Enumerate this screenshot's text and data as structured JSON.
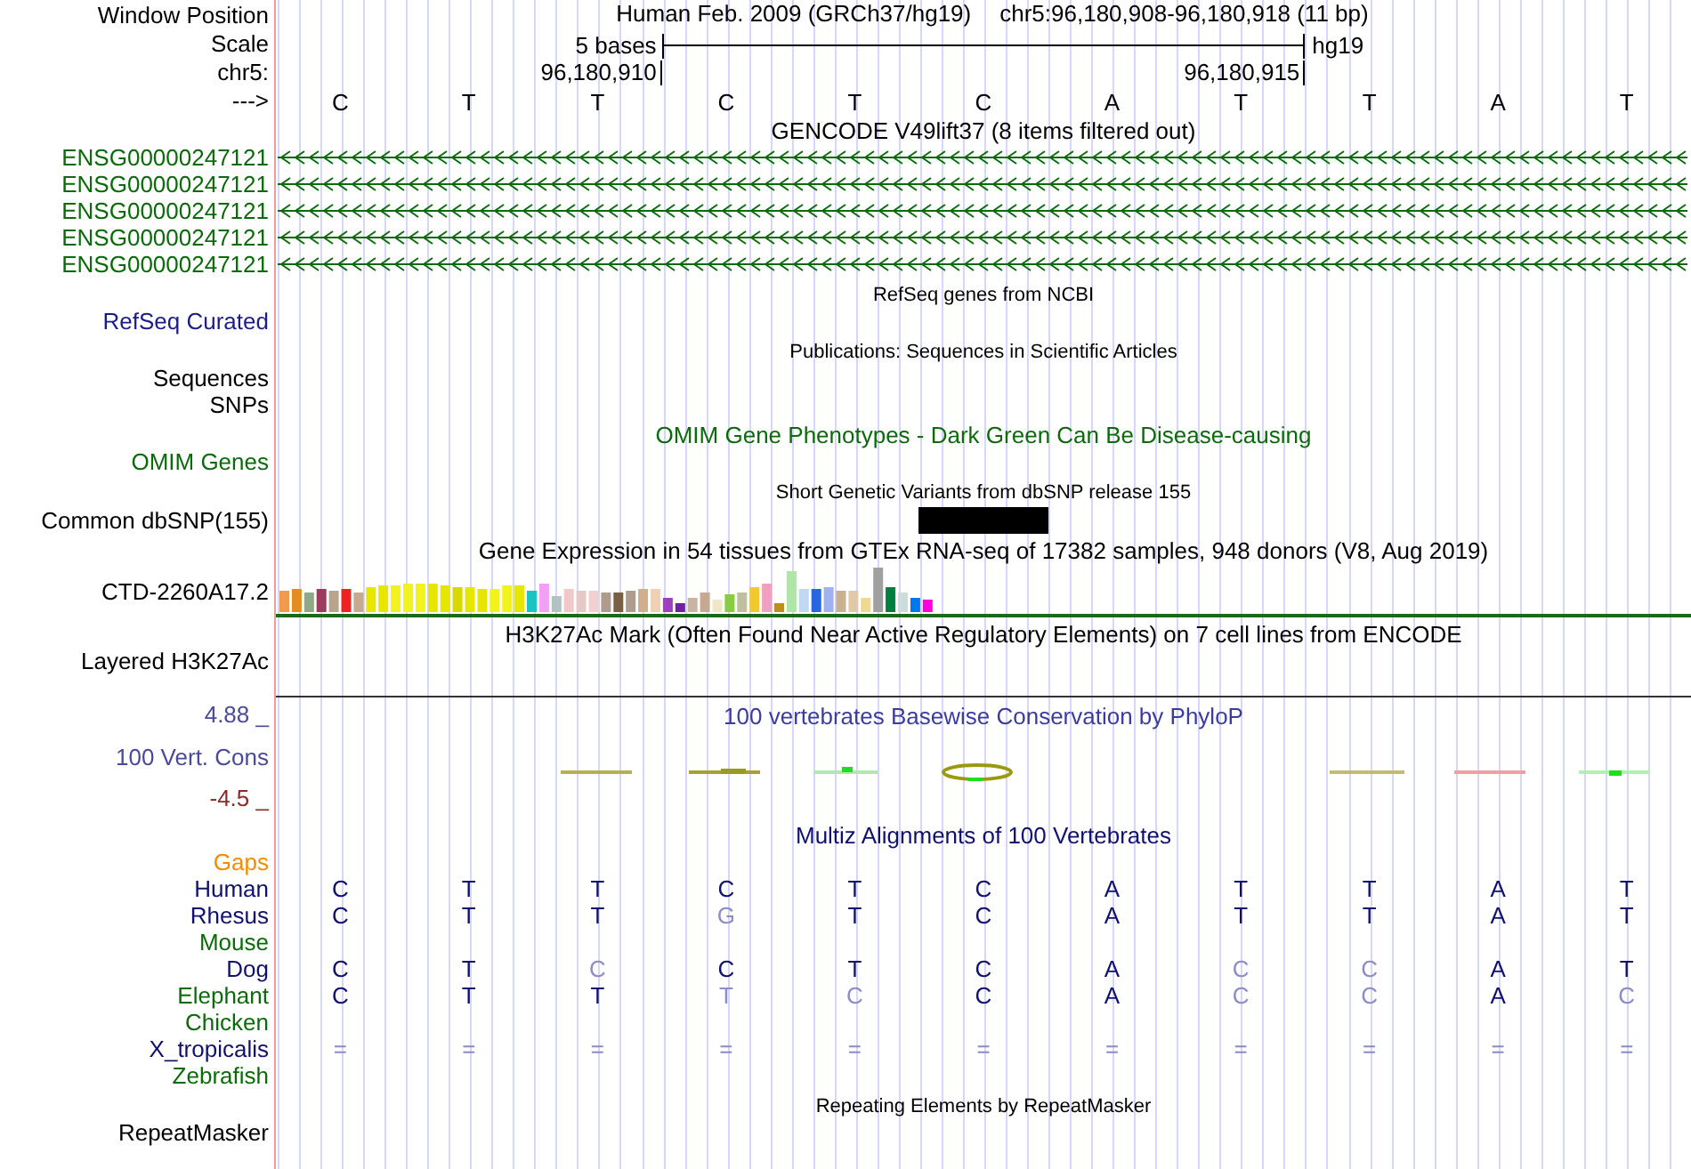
{
  "header": {
    "position": {
      "label": "Window Position",
      "assembly": "Human Feb. 2009 (GRCh37/hg19)",
      "range": "chr5:96,180,908-96,180,918 (11 bp)"
    },
    "scale": {
      "label": "Scale",
      "length": "5 bases",
      "genome": "hg19"
    },
    "ruler": {
      "label": "chr5:",
      "ticks": [
        "96,180,910",
        "96,180,915"
      ]
    },
    "sequence": {
      "label": "--->",
      "bases": [
        "C",
        "T",
        "T",
        "C",
        "T",
        "C",
        "A",
        "T",
        "T",
        "A",
        "T"
      ]
    }
  },
  "rows": [
    {
      "kind": "title",
      "text": "GENCODE V49lift37 (8 items filtered out)",
      "color": "#000000"
    },
    {
      "kind": "gene",
      "label": "ENSG00000247121",
      "color": "#0b6b0b"
    },
    {
      "kind": "gene",
      "label": "ENSG00000247121",
      "color": "#0b6b0b"
    },
    {
      "kind": "gene",
      "label": "ENSG00000247121",
      "color": "#0b6b0b"
    },
    {
      "kind": "gene",
      "label": "ENSG00000247121",
      "color": "#0b6b0b"
    },
    {
      "kind": "gene",
      "label": "ENSG00000247121",
      "color": "#0b6b0b"
    },
    {
      "kind": "small_title",
      "text": "RefSeq genes from NCBI",
      "color": "#000000"
    },
    {
      "kind": "label",
      "label": "RefSeq Curated",
      "color": "#1c1c8c"
    },
    {
      "kind": "small_title",
      "text": "Publications: Sequences in Scientific Articles",
      "color": "#000000"
    },
    {
      "kind": "label",
      "label": "Sequences",
      "color": "#000000"
    },
    {
      "kind": "label",
      "label": "SNPs",
      "color": "#000000"
    },
    {
      "kind": "title",
      "text": "OMIM Gene Phenotypes - Dark Green Can Be Disease-causing",
      "color": "#0b6b0b"
    },
    {
      "kind": "label",
      "label": "OMIM Genes",
      "color": "#0b6b0b"
    },
    {
      "kind": "small_title",
      "text": "Short Genetic Variants from dbSNP release 155",
      "color": "#000000"
    },
    {
      "kind": "snp",
      "label": "Common dbSNP(155)",
      "color": "#000000"
    },
    {
      "kind": "title",
      "text": "Gene Expression in 54 tissues from GTEx RNA-seq of 17382 samples, 948 donors (V8, Aug 2019)",
      "color": "#000000"
    },
    {
      "kind": "gtex",
      "label": "CTD-2260A17.2",
      "color": "#000000"
    },
    {
      "kind": "title",
      "text": "H3K27Ac Mark (Often Found Near Active Regulatory Elements) on 7 cell lines from ENCODE",
      "color": "#000000"
    },
    {
      "kind": "layered",
      "label": "Layered H3K27Ac",
      "color": "#000000"
    },
    {
      "kind": "conservation",
      "title": "100 vertebrates Basewise Conservation by PhyloP",
      "label": "100 Vert. Cons",
      "max": "4.88 _",
      "min": "-4.5 _"
    },
    {
      "kind": "title",
      "text": "Multiz Alignments of 100 Vertebrates",
      "color": "#101070"
    },
    {
      "kind": "label",
      "label": "Gaps",
      "color": "#f28c00"
    },
    {
      "kind": "species",
      "label": "Human",
      "color": "#101070",
      "bases": [
        {
          "text": "C",
          "differs": false
        },
        {
          "text": "T",
          "differs": false
        },
        {
          "text": "T",
          "differs": false
        },
        {
          "text": "C",
          "differs": false
        },
        {
          "text": "T",
          "differs": false
        },
        {
          "text": "C",
          "differs": false
        },
        {
          "text": "A",
          "differs": false
        },
        {
          "text": "T",
          "differs": false
        },
        {
          "text": "T",
          "differs": false
        },
        {
          "text": "A",
          "differs": false
        },
        {
          "text": "T",
          "differs": false
        }
      ]
    },
    {
      "kind": "species",
      "label": "Rhesus",
      "color": "#101070",
      "bases": [
        {
          "text": "C",
          "differs": false
        },
        {
          "text": "T",
          "differs": false
        },
        {
          "text": "T",
          "differs": false
        },
        {
          "text": "G",
          "differs": true
        },
        {
          "text": "T",
          "differs": false
        },
        {
          "text": "C",
          "differs": false
        },
        {
          "text": "A",
          "differs": false
        },
        {
          "text": "T",
          "differs": false
        },
        {
          "text": "T",
          "differs": false
        },
        {
          "text": "A",
          "differs": false
        },
        {
          "text": "T",
          "differs": false
        }
      ]
    },
    {
      "kind": "species",
      "label": "Mouse",
      "color": "#0b6b0b"
    },
    {
      "kind": "species",
      "label": "Dog",
      "color": "#101070",
      "bases": [
        {
          "text": "C",
          "differs": false
        },
        {
          "text": "T",
          "differs": false
        },
        {
          "text": "C",
          "differs": true
        },
        {
          "text": "C",
          "differs": false
        },
        {
          "text": "T",
          "differs": false
        },
        {
          "text": "C",
          "differs": false
        },
        {
          "text": "A",
          "differs": false
        },
        {
          "text": "C",
          "differs": true
        },
        {
          "text": "C",
          "differs": true
        },
        {
          "text": "A",
          "differs": false
        },
        {
          "text": "T",
          "differs": false
        }
      ]
    },
    {
      "kind": "species",
      "label": "Elephant",
      "color": "#0b6b0b",
      "bases": [
        {
          "text": "C",
          "differs": false
        },
        {
          "text": "T",
          "differs": false
        },
        {
          "text": "T",
          "differs": false
        },
        {
          "text": "T",
          "differs": true
        },
        {
          "text": "C",
          "differs": true
        },
        {
          "text": "C",
          "differs": false
        },
        {
          "text": "A",
          "differs": false
        },
        {
          "text": "C",
          "differs": true
        },
        {
          "text": "C",
          "differs": true
        },
        {
          "text": "A",
          "differs": false
        },
        {
          "text": "C",
          "differs": true
        }
      ]
    },
    {
      "kind": "species",
      "label": "Chicken",
      "color": "#0b6b0b"
    },
    {
      "kind": "species",
      "label": "X_tropicalis",
      "color": "#101070",
      "bases": [
        {
          "text": "=",
          "differs": true
        },
        {
          "text": "=",
          "differs": true
        },
        {
          "text": "=",
          "differs": true
        },
        {
          "text": "=",
          "differs": true
        },
        {
          "text": "=",
          "differs": true
        },
        {
          "text": "=",
          "differs": true
        },
        {
          "text": "=",
          "differs": true
        },
        {
          "text": "=",
          "differs": true
        },
        {
          "text": "=",
          "differs": true
        },
        {
          "text": "=",
          "differs": true
        },
        {
          "text": "=",
          "differs": true
        }
      ]
    },
    {
      "kind": "species",
      "label": "Zebrafish",
      "color": "#0b6b0b"
    },
    {
      "kind": "small_title",
      "text": "Repeating Elements by RepeatMasker",
      "color": "#000000"
    },
    {
      "kind": "label",
      "label": "RepeatMasker",
      "color": "#000000"
    }
  ]
}
